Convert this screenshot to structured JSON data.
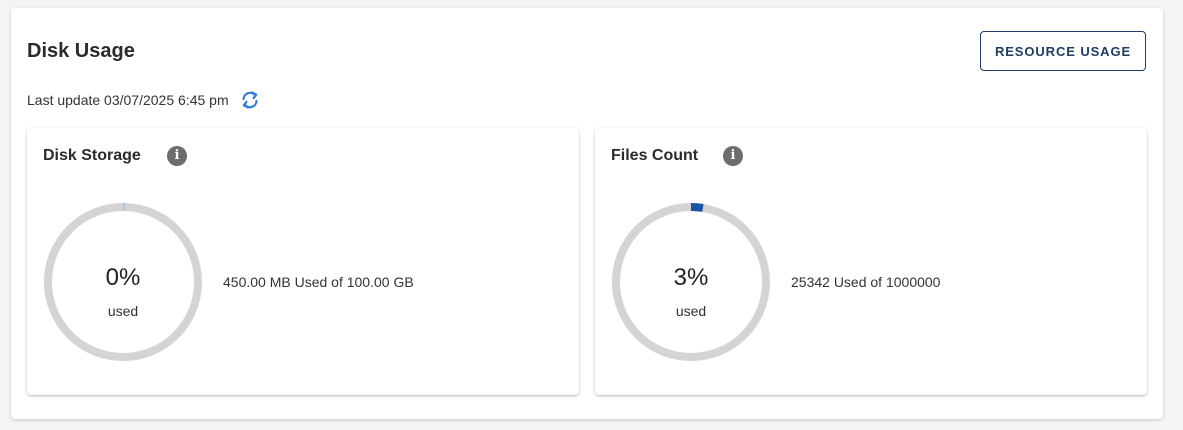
{
  "page": {
    "title": "Disk Usage",
    "resource_button_label": "RESOURCE USAGE",
    "last_update_label": "Last update 03/07/2025 6:45 pm",
    "refresh_icon": "refresh-icon"
  },
  "cards": [
    {
      "title": "Disk Storage",
      "info_icon": "info-icon",
      "percent_label": "0%",
      "percent_value": 0.45,
      "used_label": "used",
      "usage_text": "450.00 MB Used of 100.00 GB"
    },
    {
      "title": "Files Count",
      "info_icon": "info-icon",
      "percent_label": "3%",
      "percent_value": 2.5342,
      "used_label": "used",
      "usage_text": "25342 Used of 1000000"
    }
  ],
  "colors": {
    "track": "#d4d4d4",
    "arc_disk": "#a7c7e7",
    "arc_files": "#1a56a8",
    "button_border": "#1f3d66",
    "refresh": "#2f7fd6"
  }
}
